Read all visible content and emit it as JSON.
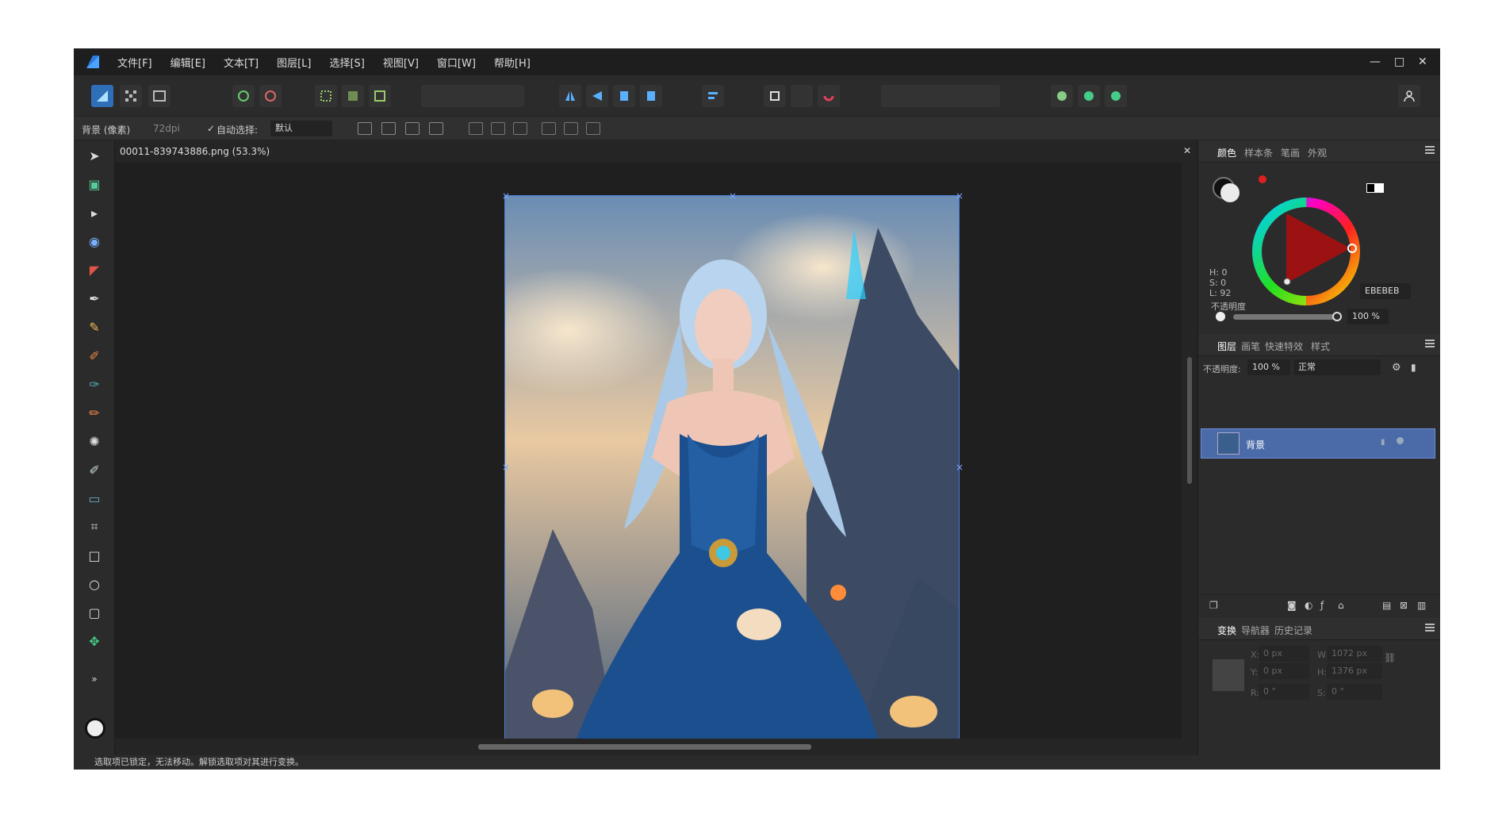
{
  "app": {
    "name": "Affinity Photo",
    "accent": "#2f6fb8"
  },
  "menu": [
    "文件[F]",
    "编辑[E]",
    "文本[T]",
    "图层[L]",
    "选择[S]",
    "视图[V]",
    "窗口[W]",
    "帮助[H]"
  ],
  "window_controls": {
    "minimize": "—",
    "maximize": "□",
    "close": "✕"
  },
  "context": {
    "layer_name": "背景 (像素)",
    "dpi": "72dpi",
    "auto_select_label": "自动选择:",
    "auto_select_value": "默认"
  },
  "document": {
    "tab_title": "00011-839743886.png (53.3%)",
    "close": "✕"
  },
  "color_panel": {
    "tabs": [
      "颜色",
      "样本条",
      "笔画",
      "外观"
    ],
    "hsl": {
      "h": "H: 0",
      "s": "S: 0",
      "l": "L: 92"
    },
    "hex": "EBEBEB",
    "opacity_label": "不透明度",
    "opacity_value": "100 %"
  },
  "layers_panel": {
    "tabs": [
      "图层",
      "画笔",
      "快速特效",
      "样式"
    ],
    "opacity_label": "不透明度:",
    "opacity_value": "100 %",
    "blend_mode": "正常",
    "layers": [
      {
        "name": "背景"
      }
    ]
  },
  "transform_panel": {
    "tabs": [
      "变换",
      "导航器",
      "历史记录"
    ],
    "x": "0 px",
    "y": "0 px",
    "w": "1072 px",
    "h": "1376 px",
    "r": "0 °",
    "s": "0 °",
    "labels": {
      "x": "X:",
      "y": "Y:",
      "w": "W:",
      "h": "H:",
      "r": "R:",
      "s": "S:"
    }
  },
  "status": "选取项已锁定，无法移动。解锁选取项对其进行变换。"
}
